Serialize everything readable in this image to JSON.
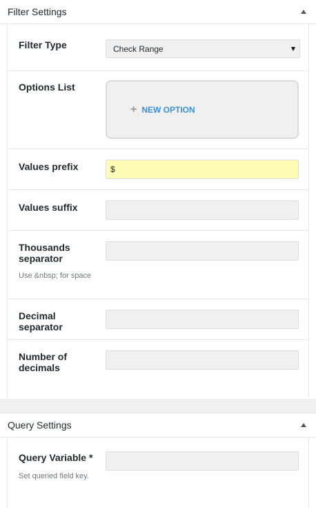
{
  "filter_settings": {
    "title": "Filter Settings",
    "filter_type": {
      "label": "Filter Type",
      "value": "Check Range"
    },
    "options_list": {
      "label": "Options List",
      "new_option_label": "NEW OPTION"
    },
    "values_prefix": {
      "label": "Values prefix",
      "value": "$"
    },
    "values_suffix": {
      "label": "Values suffix",
      "value": ""
    },
    "thousands_separator": {
      "label_line1": "Thousands",
      "label_line2": "separator",
      "hint": "Use &nbsp; for space",
      "value": ""
    },
    "decimal_separator": {
      "label": "Decimal separator",
      "value": ""
    },
    "number_of_decimals": {
      "label_line1": "Number of",
      "label_line2": "decimals",
      "value": ""
    }
  },
  "query_settings": {
    "title": "Query Settings",
    "query_variable": {
      "label": "Query Variable *",
      "hint": "Set queried field key.",
      "value": ""
    }
  },
  "colors": {
    "prefix_highlight": "#fcfcb4",
    "link_blue": "#3e8ed0",
    "field_bg": "#f0f0f0"
  },
  "icons": [
    "collapse-up-icon",
    "plus-icon",
    "dropdown-arrow-icon"
  ]
}
